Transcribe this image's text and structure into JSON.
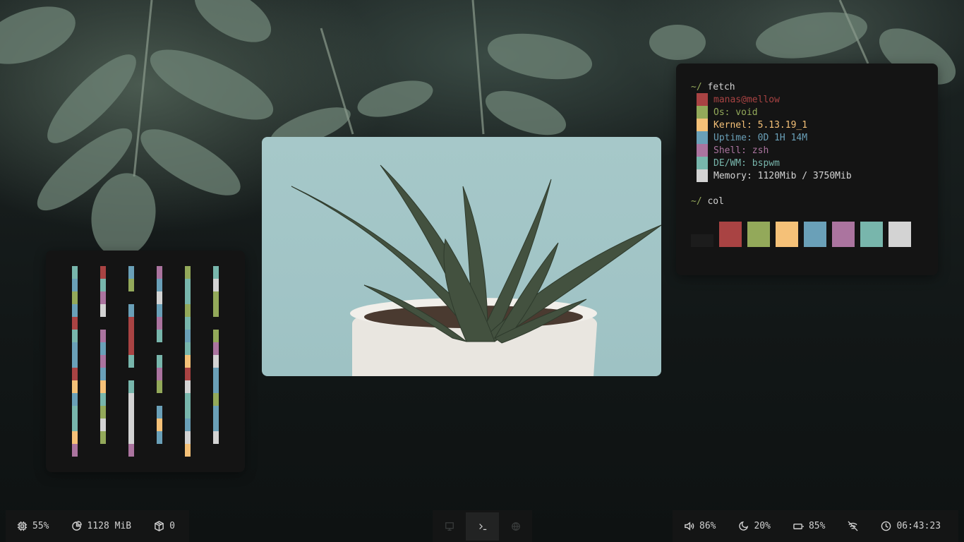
{
  "colors": {
    "black": "#1c1c1c",
    "red": "#a94343",
    "green": "#93a95a",
    "yellow": "#f5c178",
    "blue": "#6aa0b8",
    "magenta": "#ab749f",
    "cyan": "#78b6ac",
    "white": "#d3d3d3",
    "bg": "#141414"
  },
  "bars_widget": {
    "columns": [
      "cbgbrcbbrybccym",
      "rcmw_mbmbycgwg_",
      "bg_brrrc_cwwwwm",
      "mbwbmc_cmg_byb_",
      "gccgcbcyrwccbwy",
      "cwgg_gmwbbgbbw_"
    ]
  },
  "photo": {
    "subject": "aloe plant in white pot"
  },
  "fetch": {
    "prompt1": "~/",
    "cmd1": "fetch",
    "lines": [
      {
        "text": "manas@mellow",
        "color": "red"
      },
      {
        "text": "Os: void",
        "color": "green"
      },
      {
        "text": "Kernel: 5.13.19_1",
        "color": "yellow"
      },
      {
        "text": "Uptime: 0D 1H 14M",
        "color": "blue"
      },
      {
        "text": "Shell: zsh",
        "color": "magenta"
      },
      {
        "text": "DE/WM: bspwm",
        "color": "cyan"
      },
      {
        "text": "Memory: 1120Mib / 3750Mib",
        "color": "white"
      }
    ],
    "prompt2": "~/",
    "cmd2": "col",
    "palette": [
      "black",
      "red",
      "green",
      "yellow",
      "blue",
      "magenta",
      "cyan",
      "white"
    ]
  },
  "statusbar": {
    "left": {
      "cpu": "55%",
      "cpu_icon": "cpu-icon",
      "memory": "1128 MiB",
      "memory_icon": "pie-chart-icon",
      "updates": "0",
      "updates_icon": "package-icon"
    },
    "workspaces": [
      {
        "icon": "monitor-icon",
        "active": false
      },
      {
        "icon": "terminal-icon",
        "active": true
      },
      {
        "icon": "globe-icon",
        "active": false
      }
    ],
    "right": {
      "volume": "86%",
      "volume_icon": "volume-icon",
      "brightness": "20%",
      "brightness_icon": "moon-icon",
      "battery": "85%",
      "battery_icon": "battery-icon",
      "wifi_icon": "wifi-off-icon",
      "time": "06:43:23",
      "time_icon": "clock-icon"
    }
  }
}
